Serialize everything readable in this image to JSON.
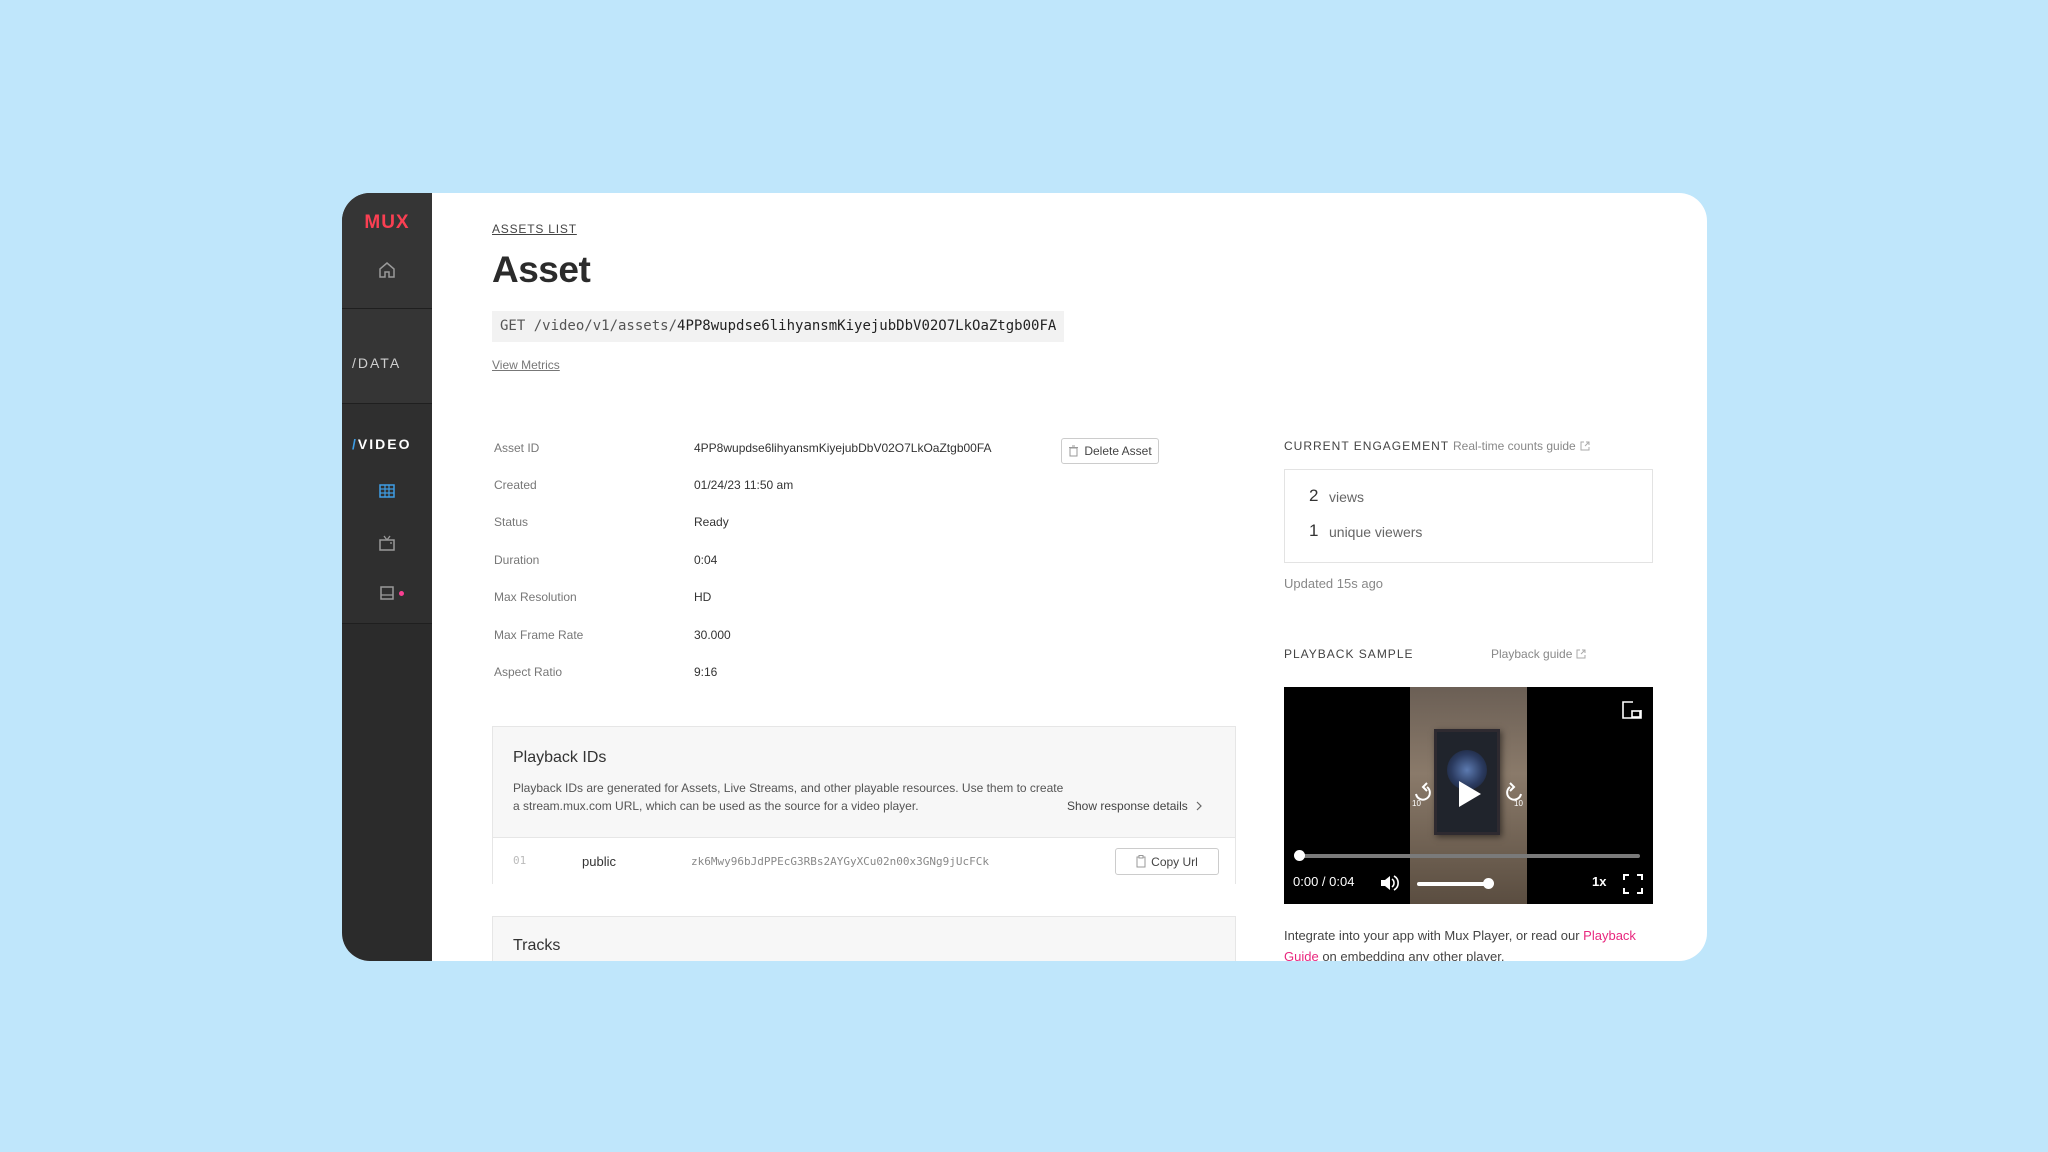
{
  "sidebar": {
    "logo": "MUX",
    "data_label": "DATA",
    "video_label": "VIDEO",
    "slash": "/"
  },
  "main": {
    "breadcrumb": "ASSETS LIST",
    "title": "Asset",
    "endpoint_prefix": "GET /video/v1/assets/",
    "endpoint_id": "4PP8wupdse6lihyansmKiyejubDbV02O7LkOaZtgb00FA",
    "view_metrics": "View Metrics",
    "delete_button": "Delete Asset",
    "meta": [
      {
        "label": "Asset ID",
        "value": "4PP8wupdse6lihyansmKiyejubDbV02O7LkOaZtgb00FA"
      },
      {
        "label": "Created",
        "value": "01/24/23 11:50 am"
      },
      {
        "label": "Status",
        "value": "Ready"
      },
      {
        "label": "Duration",
        "value": "0:04"
      },
      {
        "label": "Max Resolution",
        "value": "HD"
      },
      {
        "label": "Max Frame Rate",
        "value": "30.000"
      },
      {
        "label": "Aspect Ratio",
        "value": "9:16"
      }
    ],
    "playback_ids": {
      "title": "Playback IDs",
      "description": "Playback IDs are generated for Assets, Live Streams, and other playable resources. Use them to create a stream.mux.com URL, which can be used as the source for a video player.",
      "show_details": "Show response details",
      "row": {
        "index": "01",
        "policy": "public",
        "id": "zk6Mwy96bJdPPEcG3RBs2AYGyXCu02n00x3GNg9jUcFCk",
        "copy": "Copy Url"
      }
    },
    "tracks_title": "Tracks"
  },
  "engagement": {
    "title": "CURRENT ENGAGEMENT",
    "guide": "Real-time counts guide",
    "views_count": "2",
    "views_label": "views",
    "viewers_count": "1",
    "viewers_label": "unique viewers",
    "updated": "Updated 15s ago"
  },
  "playback": {
    "title": "PLAYBACK SAMPLE",
    "guide": "Playback guide",
    "time": "0:00 / 0:04",
    "speed": "1x",
    "skip_seconds": "10",
    "progress": 0,
    "volume": 0.85,
    "integrate_text": "Integrate into your app with Mux Player, or read our",
    "integrate_link": "Playback Guide",
    "integrate_tail": "on embedding any other player."
  },
  "colors": {
    "background": "#bfe6fb",
    "accent": "#fa3f52",
    "link": "#e8277e",
    "sidebar": "#2b2b2b"
  }
}
